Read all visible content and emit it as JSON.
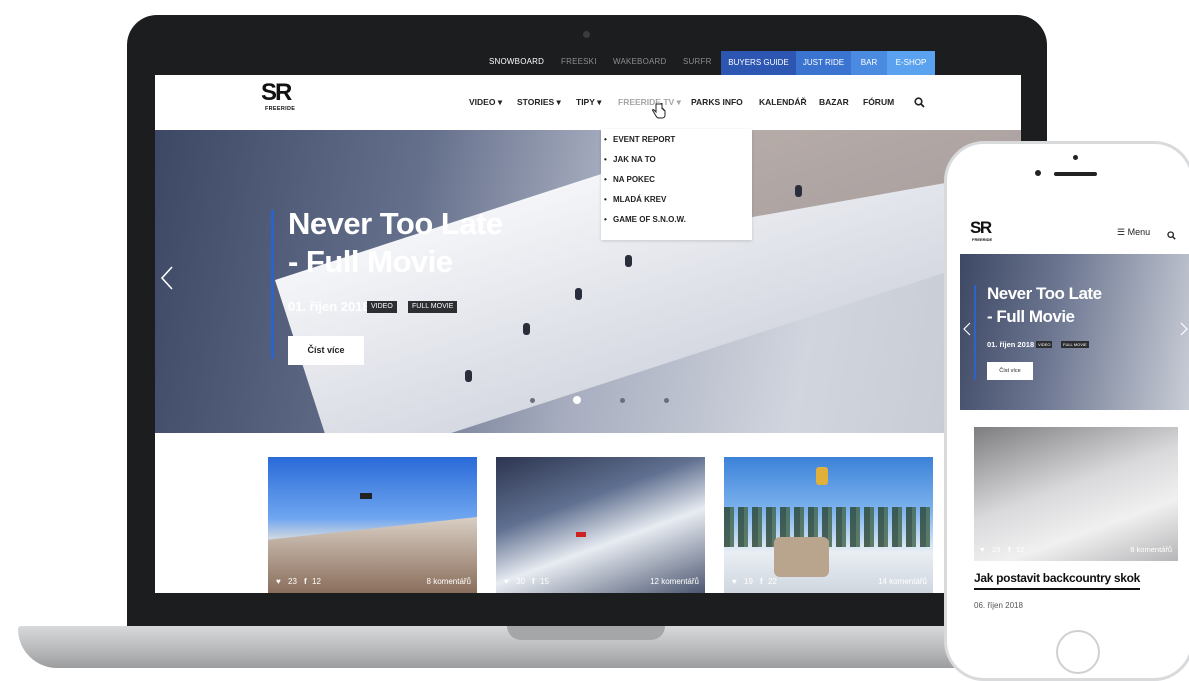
{
  "site": {
    "brand_initials": "SR",
    "brand_sub": "FREERIDE"
  },
  "topbar": {
    "links": [
      "SNOWBOARD",
      "FREESKI",
      "WAKEBOARD",
      "SURFR"
    ],
    "buttons": [
      {
        "label": "BUYERS GUIDE",
        "color": "#2d56b3"
      },
      {
        "label": "JUST RIDE",
        "color": "#3a74d0"
      },
      {
        "label": "BAR",
        "color": "#4a8ae0"
      },
      {
        "label": "E-SHOP",
        "color": "#5aa2ef"
      }
    ]
  },
  "nav": {
    "items": [
      "VIDEO",
      "STORIES",
      "TIPY",
      "FREERIDE TV",
      "PARKS INFO",
      "KALENDÁŘ",
      "BAZAR",
      "FÓRUM"
    ],
    "dropdown": [
      "EVENT REPORT",
      "JAK NA TO",
      "NA POKEC",
      "MLADÁ KREV",
      "GAME OF S.N.O.W."
    ]
  },
  "hero": {
    "title_line1": "Never Too Late",
    "title_line2": "- Full Movie",
    "date": "01. říjen 2018",
    "tags": [
      "VIDEO",
      "FULL MOVIE"
    ],
    "button": "Číst více",
    "slide_count": 4,
    "active_slide": 2
  },
  "cards": [
    {
      "likes": "23",
      "shares": "12",
      "comments": "8 komentářů"
    },
    {
      "likes": "30",
      "shares": "15",
      "comments": "12 komentářů"
    },
    {
      "likes": "19",
      "shares": "22",
      "comments": "14 komentářů"
    }
  ],
  "mobile": {
    "menu_label": "Menu",
    "hero_title_line1": "Never Too Late",
    "hero_title_line2": "- Full Movie",
    "hero_date": "01. říjen 2018",
    "hero_tags": [
      "VIDEO",
      "FULL MOVIE"
    ],
    "hero_button": "Číst více",
    "card": {
      "likes": "23",
      "shares": "12",
      "comments": "8 komentářů",
      "title": "Jak postavit backcountry skok",
      "date": "06. říjen 2018"
    }
  }
}
